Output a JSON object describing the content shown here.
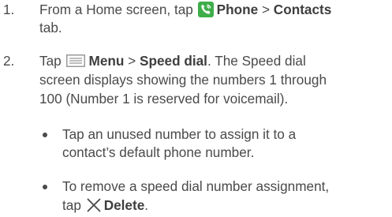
{
  "steps": [
    {
      "number": "1.",
      "line1_pre": "From a Home screen, tap",
      "phone_label": "Phone",
      "separator": ">",
      "contacts_label": "Contacts",
      "line2": "tab."
    },
    {
      "number": "2.",
      "tap": "Tap",
      "menu_label": "Menu",
      "separator": ">",
      "speed_dial_label": "Speed dial",
      "line1_post": ". The Speed dial",
      "line2": "screen displays showing the numbers 1 through",
      "line3": "100 (Number 1 is reserved for voicemail)."
    }
  ],
  "bullets": [
    {
      "line1": "Tap an unused number to assign it to a",
      "line2": "contact’s default phone number."
    },
    {
      "line1": "To remove a speed dial number assignment,",
      "line2_pre": "tap",
      "delete_label": "Delete",
      "line2_post": "."
    }
  ],
  "icons": {
    "phone": "phone-icon",
    "menu": "menu-icon",
    "delete": "close-icon",
    "phone_color": "#3fae4a"
  }
}
